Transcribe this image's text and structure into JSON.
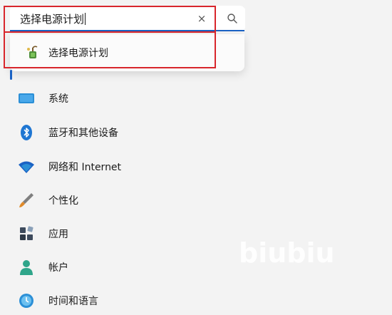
{
  "search": {
    "value": "选择电源计划",
    "clear_symbol": "×"
  },
  "suggestion": {
    "label": "选择电源计划",
    "icon": "power-plan-icon"
  },
  "nav": {
    "items": [
      {
        "label": "系统",
        "icon": "system-icon"
      },
      {
        "label": "蓝牙和其他设备",
        "icon": "bluetooth-icon"
      },
      {
        "label": "网络和 Internet",
        "icon": "wifi-icon"
      },
      {
        "label": "个性化",
        "icon": "brush-icon"
      },
      {
        "label": "应用",
        "icon": "apps-icon"
      },
      {
        "label": "帐户",
        "icon": "account-icon"
      },
      {
        "label": "时间和语言",
        "icon": "time-language-icon"
      }
    ]
  },
  "watermark": "biubiu",
  "colors": {
    "accent": "#1a62c4",
    "highlight": "#d8262c",
    "background": "#f3f3f3"
  }
}
